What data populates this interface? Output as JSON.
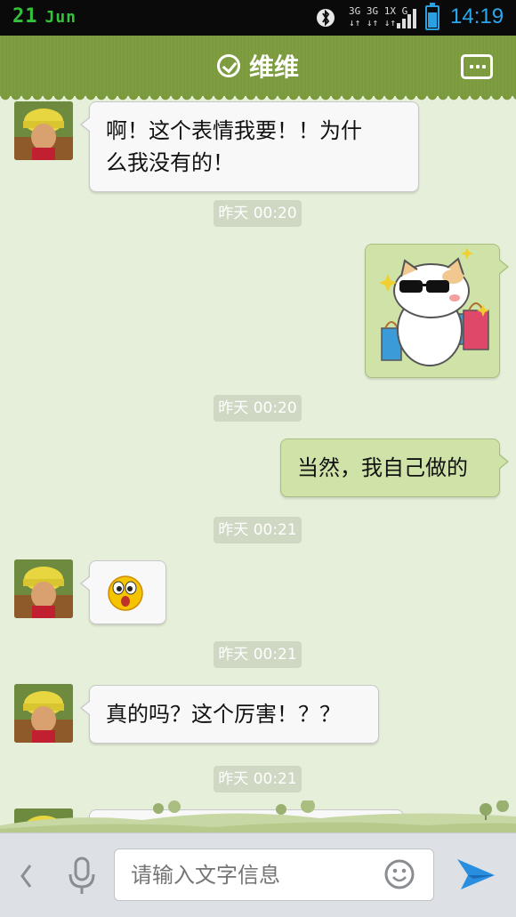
{
  "status_bar": {
    "date_day": "21",
    "date_month": "Jun",
    "network_line1": "3G 3G 1X G",
    "network_line2": "↓↑ ↓↑ ↓↑",
    "time": "14:19"
  },
  "header": {
    "title": "维维"
  },
  "messages": [
    {
      "sender": "contact",
      "text_line1": "啊！这个表情我要！！为什",
      "text_line2": "么我没有的！"
    },
    {
      "timestamp": "昨天 00:20"
    },
    {
      "sender": "me",
      "type": "sticker",
      "sticker": "cat-with-sunglasses-sticker"
    },
    {
      "timestamp": "昨天 00:20"
    },
    {
      "sender": "me",
      "text": "当然，我自己做的"
    },
    {
      "timestamp": "昨天 00:21"
    },
    {
      "sender": "contact",
      "type": "emoji",
      "emoji": "surprised-face-emoji"
    },
    {
      "timestamp": "昨天 00:21"
    },
    {
      "sender": "contact",
      "text": "真的吗？这个厉害！？？"
    },
    {
      "timestamp": "昨天 00:21"
    }
  ],
  "input": {
    "placeholder": "请输入文字信息"
  },
  "colors": {
    "header": "#7a9a3c",
    "chat_bg": "#e6efd9",
    "outgoing_bubble": "#cfe3a8",
    "incoming_bubble": "#f8f8f8",
    "time_accent": "#2aa8ee"
  }
}
